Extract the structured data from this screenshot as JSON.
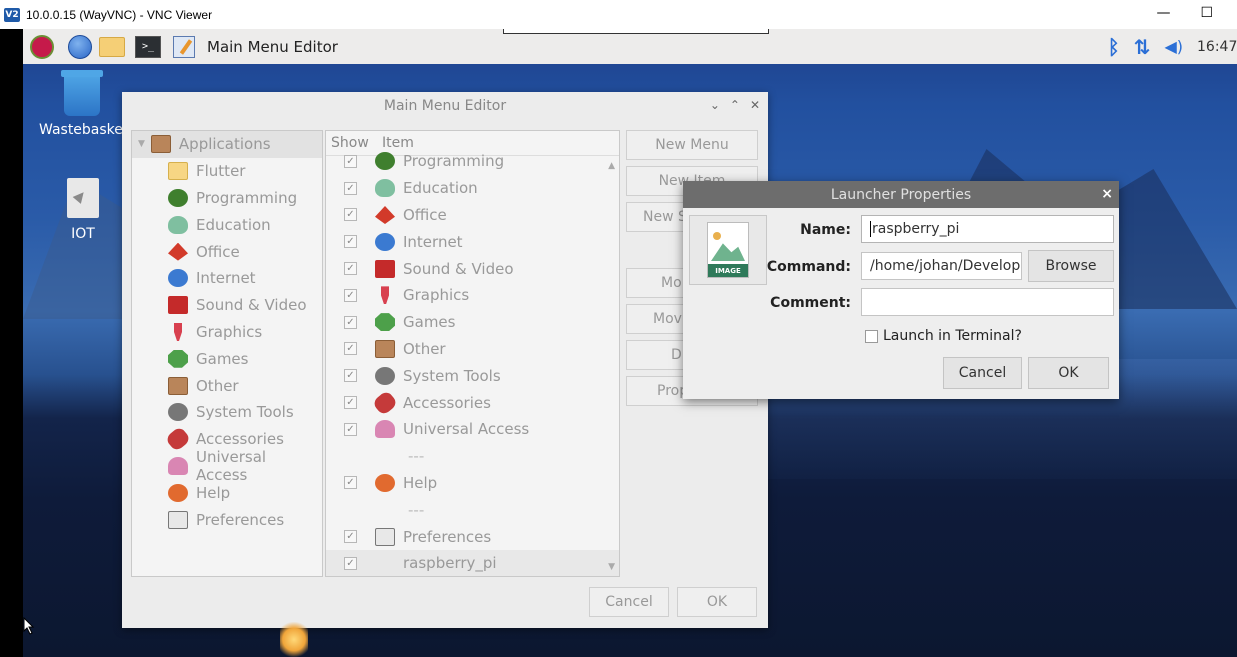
{
  "vnc": {
    "icon_text": "V2",
    "title": "10.0.0.15 (WayVNC) - VNC Viewer",
    "minimize": "—",
    "maximize": "☐"
  },
  "taskbar": {
    "active_window": "Main Menu Editor",
    "clock": "16:47",
    "terminal_glyph": ">_",
    "icons": [
      "raspberry-pi-menu-icon",
      "globe-icon",
      "folder-icon",
      "terminal-icon",
      "menu-editor-icon",
      "bluetooth-icon",
      "network-icon",
      "volume-icon"
    ]
  },
  "desktop": {
    "items": [
      {
        "label": "Wastebasket"
      },
      {
        "label": "IOT"
      }
    ]
  },
  "main_menu_editor": {
    "title": "Main Menu Editor",
    "window_controls": {
      "minimize": "⌄",
      "maximize": "⌃",
      "close": "✕"
    },
    "tree": {
      "root": "Applications",
      "children": [
        "Flutter",
        "Programming",
        "Education",
        "Office",
        "Internet",
        "Sound & Video",
        "Graphics",
        "Games",
        "Other",
        "System Tools",
        "Accessories",
        "Universal Access",
        "Help",
        "Preferences"
      ]
    },
    "list": {
      "header_show": "Show",
      "header_item": "Item",
      "rows": [
        "Programming",
        "Education",
        "Office",
        "Internet",
        "Sound & Video",
        "Graphics",
        "Games",
        "Other",
        "System Tools",
        "Accessories",
        "Universal Access",
        "---",
        "Help",
        "---",
        "Preferences",
        "raspberry_pi"
      ]
    },
    "buttons": {
      "new_menu": "New Menu",
      "new_item": "New Item",
      "new_separator": "New S",
      "move_up": "Mo",
      "move_down": "Mov",
      "delete": "D",
      "properties": "Prop"
    },
    "footer": {
      "cancel": "Cancel",
      "ok": "OK"
    }
  },
  "launcher_properties": {
    "title": "Launcher Properties",
    "close": "×",
    "image_tag": "IMAGE",
    "name_label": "Name:",
    "name_value": "raspberry_pi",
    "command_label": "Command:",
    "command_value": "/home/johan/Develop",
    "browse": "Browse",
    "comment_label": "Comment:",
    "comment_value": "",
    "terminal_check": "Launch in Terminal?",
    "cancel": "Cancel",
    "ok": "OK"
  }
}
